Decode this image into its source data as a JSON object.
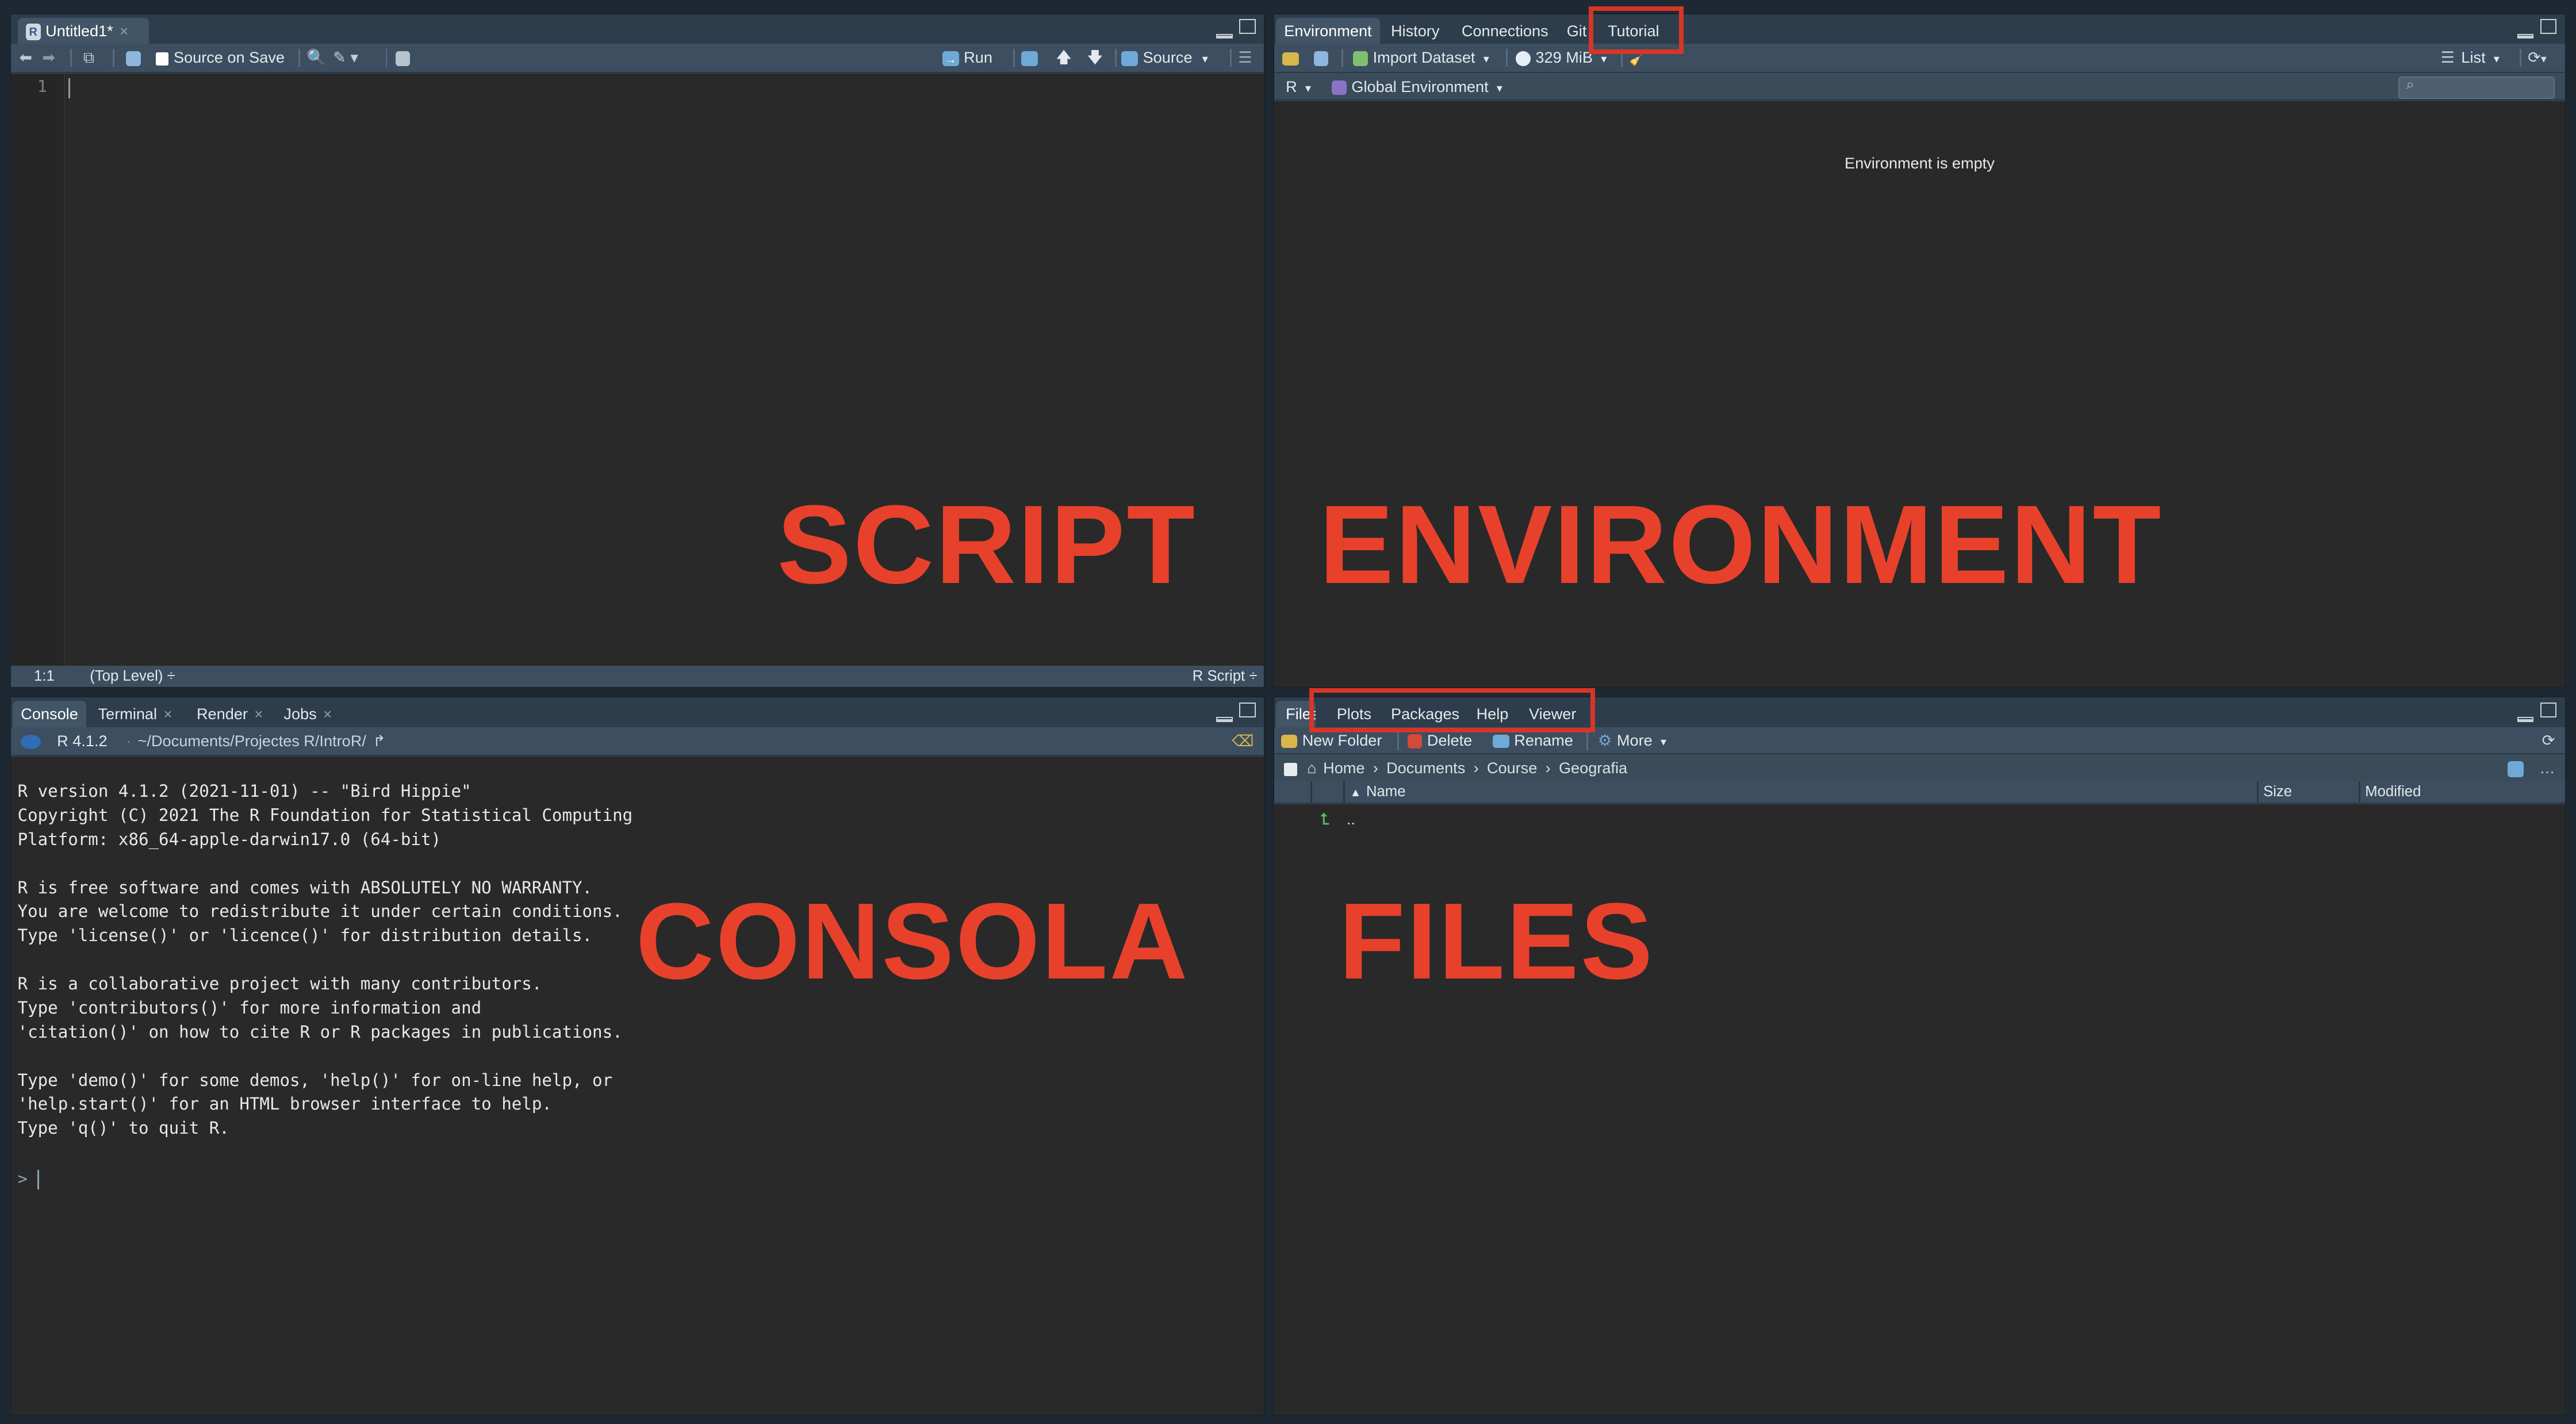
{
  "colors": {
    "annotation": "#e8412b",
    "highlight_box": "#d63527",
    "pane_bg": "#292929",
    "toolbar_bg": "#3c4e5f"
  },
  "script_pane": {
    "tab_label": "Untitled1*",
    "toolbar": {
      "source_on_save": "Source on Save",
      "run": "Run",
      "source": "Source"
    },
    "line_number": "1",
    "status": {
      "position": "1:1",
      "scope": "(Top Level) ÷",
      "file_type": "R Script ÷"
    }
  },
  "environment_pane": {
    "tabs": [
      "Environment",
      "History",
      "Connections",
      "Git",
      "Tutorial"
    ],
    "toolbar": {
      "import_dataset": "Import Dataset",
      "memory": "329 MiB",
      "view_mode": "List"
    },
    "scope_r": "R",
    "scope_env": "Global Environment",
    "empty_message": "Environment is empty"
  },
  "console_pane": {
    "tabs": [
      "Console",
      "Terminal",
      "Render",
      "Jobs"
    ],
    "r_version": "R 4.1.2",
    "path": "~/Documents/Projectes R/IntroR/",
    "output": "R version 4.1.2 (2021-11-01) -- \"Bird Hippie\"\nCopyright (C) 2021 The R Foundation for Statistical Computing\nPlatform: x86_64-apple-darwin17.0 (64-bit)\n\nR is free software and comes with ABSOLUTELY NO WARRANTY.\nYou are welcome to redistribute it under certain conditions.\nType 'license()' or 'licence()' for distribution details.\n\nR is a collaborative project with many contributors.\nType 'contributors()' for more information and\n'citation()' on how to cite R or R packages in publications.\n\nType 'demo()' for some demos, 'help()' for on-line help, or\n'help.start()' for an HTML browser interface to help.\nType 'q()' to quit R.",
    "prompt": ">"
  },
  "files_pane": {
    "tabs": [
      "Files",
      "Plots",
      "Packages",
      "Help",
      "Viewer"
    ],
    "toolbar": {
      "new_folder": "New Folder",
      "delete": "Delete",
      "rename": "Rename",
      "more": "More"
    },
    "breadcrumb": [
      "Home",
      "Documents",
      "Course",
      "Geografia"
    ],
    "columns": {
      "name": "Name",
      "size": "Size",
      "modified": "Modified"
    },
    "rows": [
      {
        "name": ".."
      }
    ]
  },
  "annotations": {
    "script": "SCRIPT",
    "environment": "ENVIRONMENT",
    "console": "CONSOLA",
    "files": "FILES"
  }
}
